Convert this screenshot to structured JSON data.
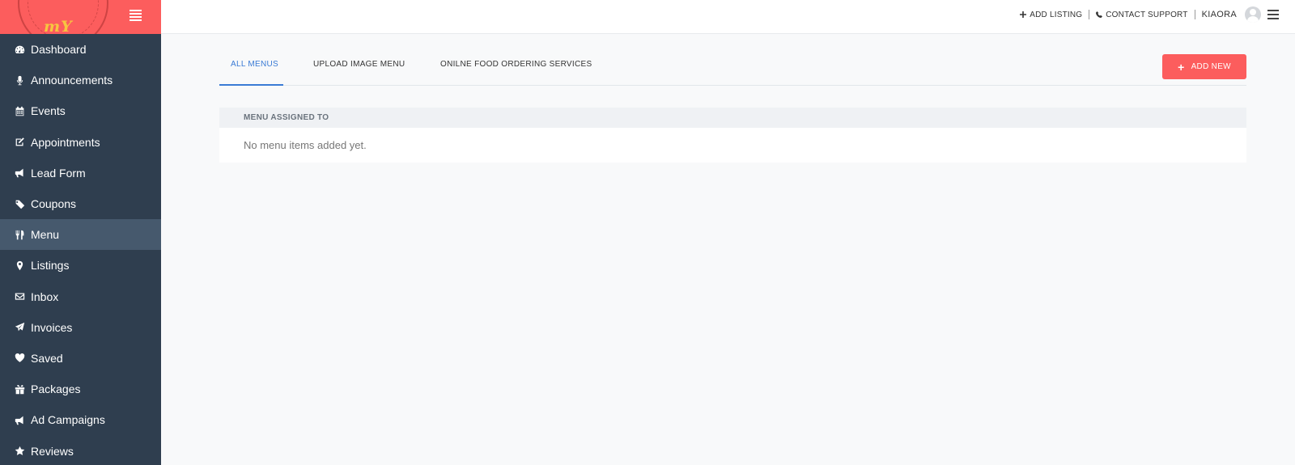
{
  "brand": {
    "logo_text": "mY",
    "header_color": "#fc5d5d"
  },
  "sidebar": {
    "items": [
      {
        "label": "Dashboard",
        "icon": "dashboard-icon"
      },
      {
        "label": "Announcements",
        "icon": "microphone-icon"
      },
      {
        "label": "Events",
        "icon": "calendar-icon"
      },
      {
        "label": "Appointments",
        "icon": "edit-icon"
      },
      {
        "label": "Lead Form",
        "icon": "bullhorn-icon"
      },
      {
        "label": "Coupons",
        "icon": "tags-icon"
      },
      {
        "label": "Menu",
        "icon": "cutlery-icon",
        "active": true
      },
      {
        "label": "Listings",
        "icon": "map-marker-icon"
      },
      {
        "label": "Inbox",
        "icon": "envelope-icon"
      },
      {
        "label": "Invoices",
        "icon": "paper-plane-icon"
      },
      {
        "label": "Saved",
        "icon": "heart-icon"
      },
      {
        "label": "Packages",
        "icon": "gift-icon"
      },
      {
        "label": "Ad Campaigns",
        "icon": "bullhorn-icon"
      },
      {
        "label": "Reviews",
        "icon": "star-icon"
      }
    ]
  },
  "topbar": {
    "add_listing": "ADD LISTING",
    "contact_support": "CONTACT SUPPORT",
    "username": "KIAORA"
  },
  "tabs": [
    {
      "label": "ALL MENUS",
      "active": true
    },
    {
      "label": "UPLOAD IMAGE MENU"
    },
    {
      "label": "ONILNE FOOD ORDERING SERVICES"
    }
  ],
  "add_new_label": "ADD NEW",
  "table": {
    "header": "MENU ASSIGNED TO",
    "empty_message": "No menu items added yet."
  },
  "colors": {
    "accent": "#3a7bd5",
    "button": "#fc5d5d",
    "sidebar_bg": "#2f3e4f",
    "sidebar_active": "#46596d"
  }
}
